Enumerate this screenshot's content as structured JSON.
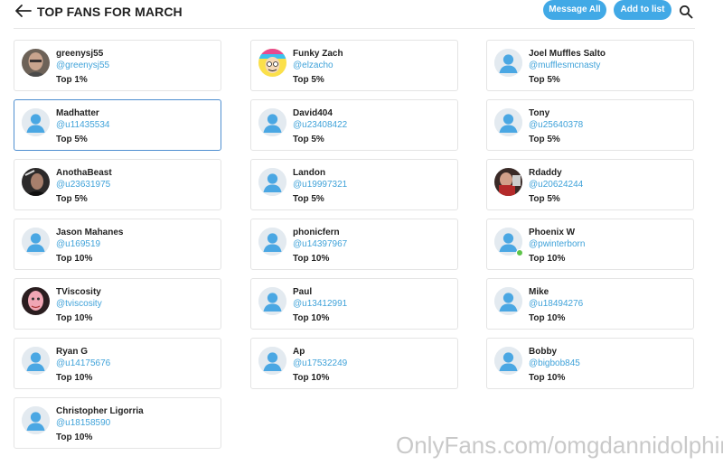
{
  "header": {
    "title": "TOP FANS FOR MARCH",
    "message_all_label": "Message All",
    "add_to_list_label": "Add to list",
    "accent_color": "#41a9e6"
  },
  "fans": [
    {
      "name": "greenysj55",
      "handle": "@greenysj55",
      "rank": "Top 1%",
      "avatar": "photo-bald-man"
    },
    {
      "name": "Funky Zach",
      "handle": "@elzacho",
      "rank": "Top 5%",
      "avatar": "cartoon-rainbow"
    },
    {
      "name": "Joel Muffles Salto",
      "handle": "@mufflesmcnasty",
      "rank": "Top 5%",
      "avatar": "default"
    },
    {
      "name": "Madhatter",
      "handle": "@u11435534",
      "rank": "Top 5%",
      "avatar": "default",
      "selected": true
    },
    {
      "name": "David404",
      "handle": "@u23408422",
      "rank": "Top 5%",
      "avatar": "default"
    },
    {
      "name": "Tony",
      "handle": "@u25640378",
      "rank": "Top 5%",
      "avatar": "default"
    },
    {
      "name": "AnothaBeast",
      "handle": "@u23631975",
      "rank": "Top 5%",
      "avatar": "photo-dark"
    },
    {
      "name": "Landon",
      "handle": "@u19997321",
      "rank": "Top 5%",
      "avatar": "default"
    },
    {
      "name": "Rdaddy",
      "handle": "@u20624244",
      "rank": "Top 5%",
      "avatar": "photo-red"
    },
    {
      "name": "Jason Mahanes",
      "handle": "@u169519",
      "rank": "Top 10%",
      "avatar": "default"
    },
    {
      "name": "phonicfern",
      "handle": "@u14397967",
      "rank": "Top 10%",
      "avatar": "default"
    },
    {
      "name": "Phoenix W",
      "handle": "@pwinterborn",
      "rank": "Top 10%",
      "avatar": "default",
      "online": true
    },
    {
      "name": "TViscosity",
      "handle": "@tviscosity",
      "rank": "Top 10%",
      "avatar": "photo-pink"
    },
    {
      "name": "Paul",
      "handle": "@u13412991",
      "rank": "Top 10%",
      "avatar": "default"
    },
    {
      "name": "Mike",
      "handle": "@u18494276",
      "rank": "Top 10%",
      "avatar": "default"
    },
    {
      "name": "Ryan G",
      "handle": "@u14175676",
      "rank": "Top 10%",
      "avatar": "default"
    },
    {
      "name": "Ap",
      "handle": "@u17532249",
      "rank": "Top 10%",
      "avatar": "default"
    },
    {
      "name": "Bobby",
      "handle": "@bigbob845",
      "rank": "Top 10%",
      "avatar": "default"
    },
    {
      "name": "Christopher Ligorria",
      "handle": "@u18158590",
      "rank": "Top 10%",
      "avatar": "default"
    }
  ],
  "watermark": "OnlyFans.com/omgdannidolphin"
}
